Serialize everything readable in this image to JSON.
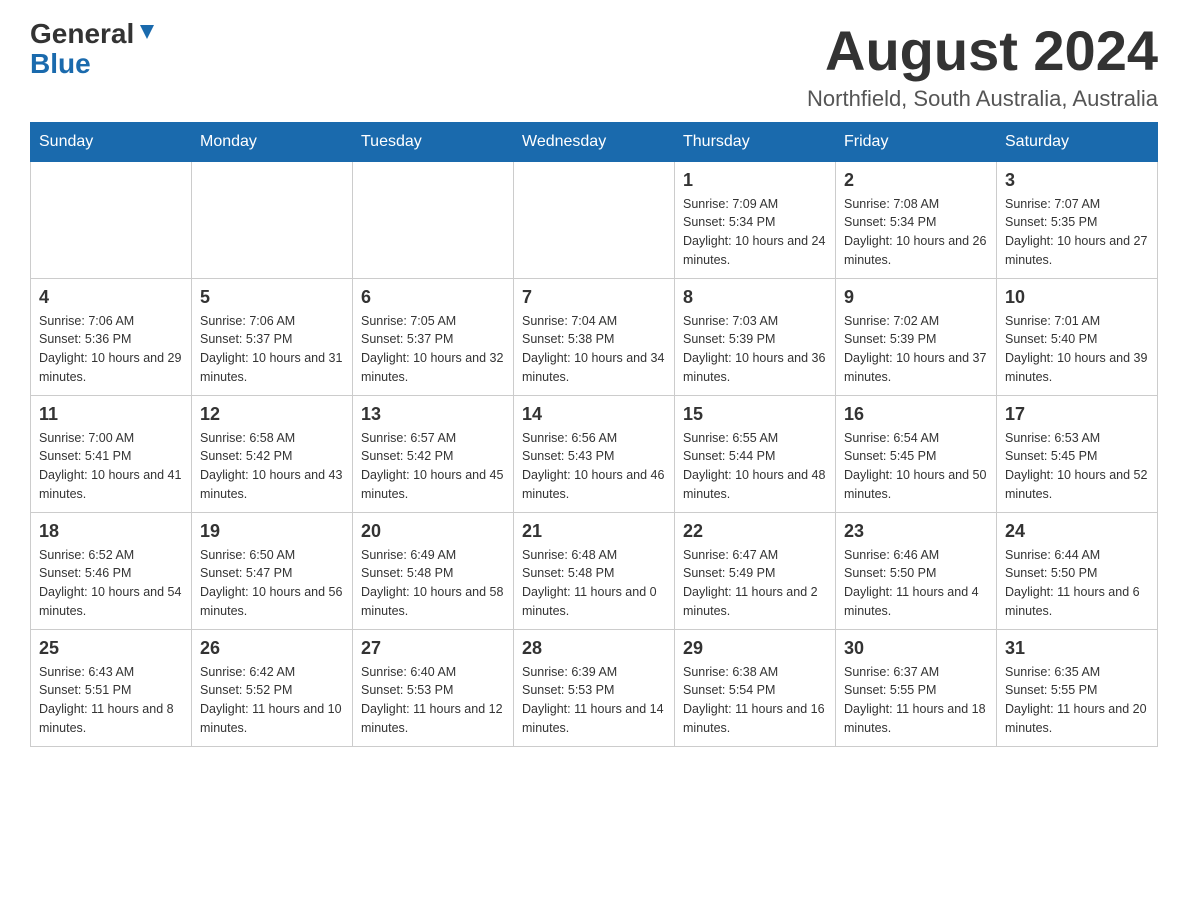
{
  "header": {
    "logo": {
      "general": "General",
      "blue": "Blue"
    },
    "title": "August 2024",
    "location": "Northfield, South Australia, Australia"
  },
  "weekdays": [
    "Sunday",
    "Monday",
    "Tuesday",
    "Wednesday",
    "Thursday",
    "Friday",
    "Saturday"
  ],
  "weeks": [
    [
      {
        "day": "",
        "info": ""
      },
      {
        "day": "",
        "info": ""
      },
      {
        "day": "",
        "info": ""
      },
      {
        "day": "",
        "info": ""
      },
      {
        "day": "1",
        "info": "Sunrise: 7:09 AM\nSunset: 5:34 PM\nDaylight: 10 hours and 24 minutes."
      },
      {
        "day": "2",
        "info": "Sunrise: 7:08 AM\nSunset: 5:34 PM\nDaylight: 10 hours and 26 minutes."
      },
      {
        "day": "3",
        "info": "Sunrise: 7:07 AM\nSunset: 5:35 PM\nDaylight: 10 hours and 27 minutes."
      }
    ],
    [
      {
        "day": "4",
        "info": "Sunrise: 7:06 AM\nSunset: 5:36 PM\nDaylight: 10 hours and 29 minutes."
      },
      {
        "day": "5",
        "info": "Sunrise: 7:06 AM\nSunset: 5:37 PM\nDaylight: 10 hours and 31 minutes."
      },
      {
        "day": "6",
        "info": "Sunrise: 7:05 AM\nSunset: 5:37 PM\nDaylight: 10 hours and 32 minutes."
      },
      {
        "day": "7",
        "info": "Sunrise: 7:04 AM\nSunset: 5:38 PM\nDaylight: 10 hours and 34 minutes."
      },
      {
        "day": "8",
        "info": "Sunrise: 7:03 AM\nSunset: 5:39 PM\nDaylight: 10 hours and 36 minutes."
      },
      {
        "day": "9",
        "info": "Sunrise: 7:02 AM\nSunset: 5:39 PM\nDaylight: 10 hours and 37 minutes."
      },
      {
        "day": "10",
        "info": "Sunrise: 7:01 AM\nSunset: 5:40 PM\nDaylight: 10 hours and 39 minutes."
      }
    ],
    [
      {
        "day": "11",
        "info": "Sunrise: 7:00 AM\nSunset: 5:41 PM\nDaylight: 10 hours and 41 minutes."
      },
      {
        "day": "12",
        "info": "Sunrise: 6:58 AM\nSunset: 5:42 PM\nDaylight: 10 hours and 43 minutes."
      },
      {
        "day": "13",
        "info": "Sunrise: 6:57 AM\nSunset: 5:42 PM\nDaylight: 10 hours and 45 minutes."
      },
      {
        "day": "14",
        "info": "Sunrise: 6:56 AM\nSunset: 5:43 PM\nDaylight: 10 hours and 46 minutes."
      },
      {
        "day": "15",
        "info": "Sunrise: 6:55 AM\nSunset: 5:44 PM\nDaylight: 10 hours and 48 minutes."
      },
      {
        "day": "16",
        "info": "Sunrise: 6:54 AM\nSunset: 5:45 PM\nDaylight: 10 hours and 50 minutes."
      },
      {
        "day": "17",
        "info": "Sunrise: 6:53 AM\nSunset: 5:45 PM\nDaylight: 10 hours and 52 minutes."
      }
    ],
    [
      {
        "day": "18",
        "info": "Sunrise: 6:52 AM\nSunset: 5:46 PM\nDaylight: 10 hours and 54 minutes."
      },
      {
        "day": "19",
        "info": "Sunrise: 6:50 AM\nSunset: 5:47 PM\nDaylight: 10 hours and 56 minutes."
      },
      {
        "day": "20",
        "info": "Sunrise: 6:49 AM\nSunset: 5:48 PM\nDaylight: 10 hours and 58 minutes."
      },
      {
        "day": "21",
        "info": "Sunrise: 6:48 AM\nSunset: 5:48 PM\nDaylight: 11 hours and 0 minutes."
      },
      {
        "day": "22",
        "info": "Sunrise: 6:47 AM\nSunset: 5:49 PM\nDaylight: 11 hours and 2 minutes."
      },
      {
        "day": "23",
        "info": "Sunrise: 6:46 AM\nSunset: 5:50 PM\nDaylight: 11 hours and 4 minutes."
      },
      {
        "day": "24",
        "info": "Sunrise: 6:44 AM\nSunset: 5:50 PM\nDaylight: 11 hours and 6 minutes."
      }
    ],
    [
      {
        "day": "25",
        "info": "Sunrise: 6:43 AM\nSunset: 5:51 PM\nDaylight: 11 hours and 8 minutes."
      },
      {
        "day": "26",
        "info": "Sunrise: 6:42 AM\nSunset: 5:52 PM\nDaylight: 11 hours and 10 minutes."
      },
      {
        "day": "27",
        "info": "Sunrise: 6:40 AM\nSunset: 5:53 PM\nDaylight: 11 hours and 12 minutes."
      },
      {
        "day": "28",
        "info": "Sunrise: 6:39 AM\nSunset: 5:53 PM\nDaylight: 11 hours and 14 minutes."
      },
      {
        "day": "29",
        "info": "Sunrise: 6:38 AM\nSunset: 5:54 PM\nDaylight: 11 hours and 16 minutes."
      },
      {
        "day": "30",
        "info": "Sunrise: 6:37 AM\nSunset: 5:55 PM\nDaylight: 11 hours and 18 minutes."
      },
      {
        "day": "31",
        "info": "Sunrise: 6:35 AM\nSunset: 5:55 PM\nDaylight: 11 hours and 20 minutes."
      }
    ]
  ]
}
